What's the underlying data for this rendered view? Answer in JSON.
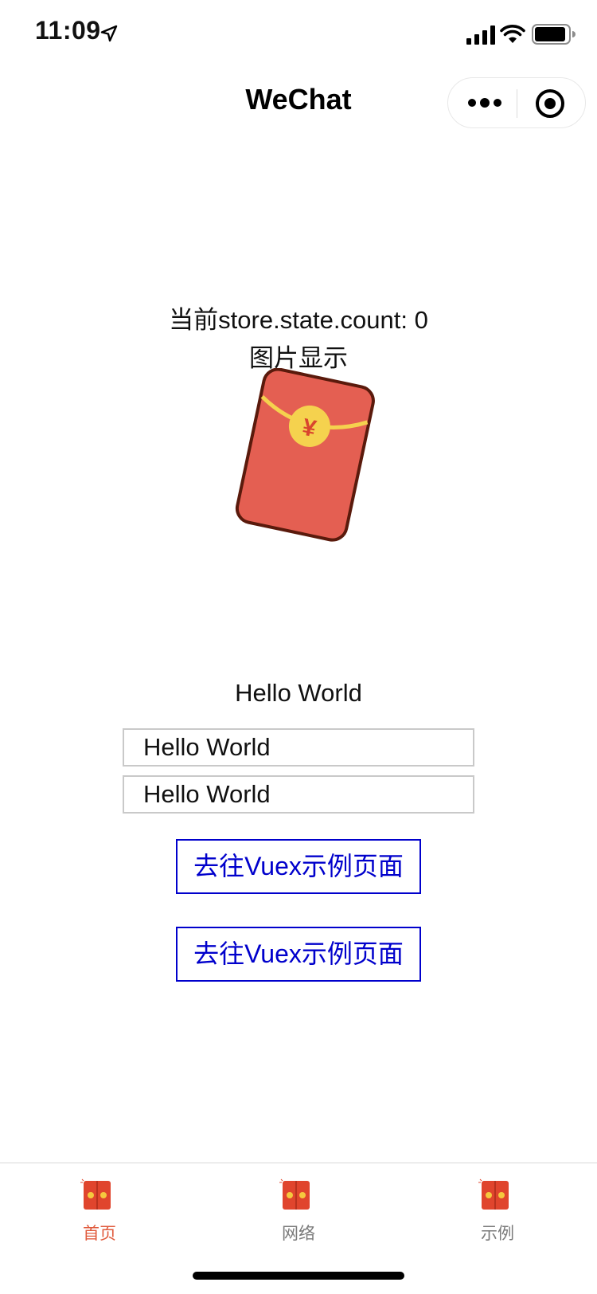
{
  "status_bar": {
    "time": "11:09"
  },
  "nav": {
    "title": "WeChat"
  },
  "content": {
    "count_label": "当前store.state.count: 0",
    "image_title": "图片显示",
    "hello_text": "Hello World",
    "input_1_value": "Hello World",
    "input_2_value": "Hello World",
    "button_1_label": "去往Vuex示例页面",
    "button_2_label": "去往Vuex示例页面",
    "packet_symbol": "¥"
  },
  "tab_bar": {
    "items": [
      {
        "label": "首页",
        "icon": "red-packet-icon",
        "active": true
      },
      {
        "label": "网络",
        "icon": "red-packet-icon",
        "active": false
      },
      {
        "label": "示例",
        "icon": "red-packet-icon",
        "active": false
      }
    ]
  },
  "colors": {
    "link_blue": "#0000cc",
    "tab_active": "#e05a3c",
    "tab_inactive": "#7a7a7a",
    "packet_red": "#e45f52",
    "packet_gold": "#f5d24e"
  }
}
